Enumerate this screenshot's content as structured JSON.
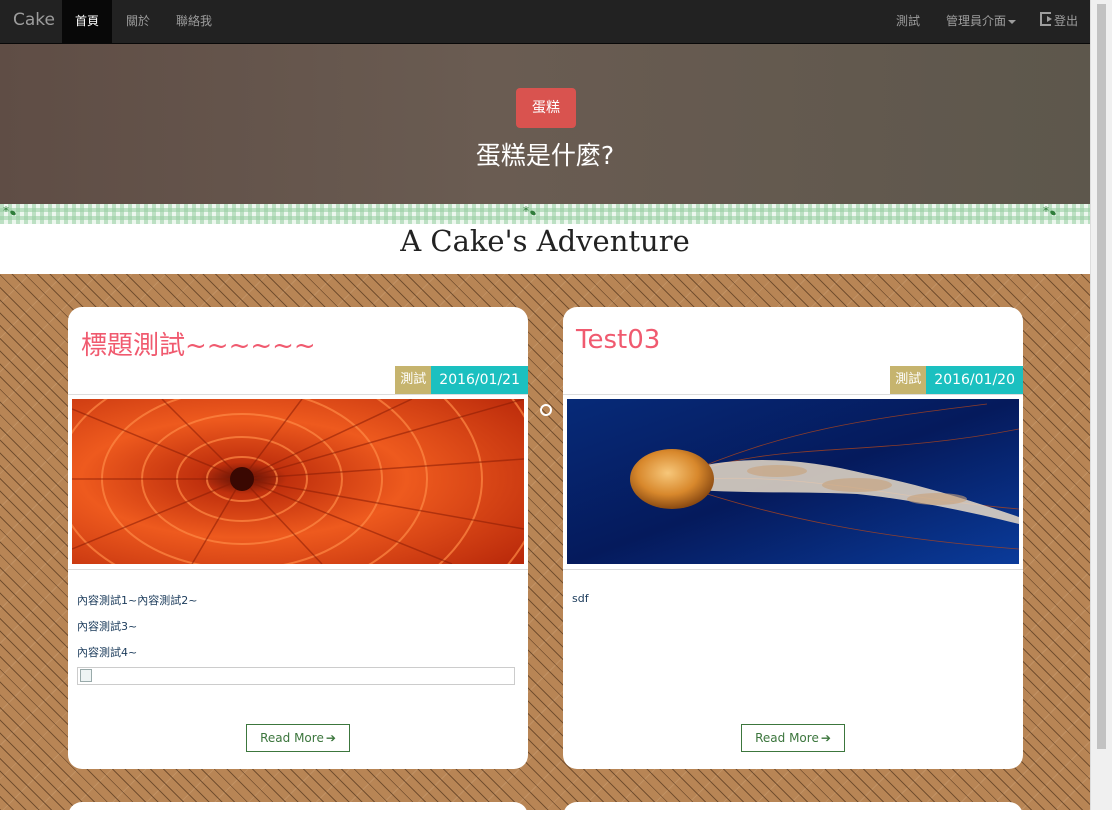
{
  "navbar": {
    "brand": "Cake",
    "items": [
      {
        "label": "首頁"
      },
      {
        "label": "關於"
      },
      {
        "label": "聯絡我"
      }
    ],
    "right": [
      {
        "label": "測試"
      },
      {
        "label": "管理員介面"
      },
      {
        "label": "登出"
      }
    ]
  },
  "hero": {
    "badge": "蛋糕",
    "title": "蛋糕是什麼?"
  },
  "site_title": "A Cake's Adventure",
  "posts": [
    {
      "title": "標題測試~~~~~~",
      "category": "測試",
      "date": "2016/01/21",
      "image": "orange-chrysanthemum",
      "body": [
        "內容測試1~內容測試2~",
        "內容測試3~",
        "內容測試4~"
      ],
      "read_more": "Read More"
    },
    {
      "title": "Test03",
      "category": "測試",
      "date": "2016/01/20",
      "image": "jellyfish",
      "body": [
        "sdf"
      ],
      "read_more": "Read More"
    }
  ],
  "colors": {
    "navbar": "#222222",
    "badge": "#d9534f",
    "card_title": "#f05a6f",
    "category_tag": "#c6b46e",
    "date_tag": "#1bc0c0",
    "button": "#3c763d"
  }
}
